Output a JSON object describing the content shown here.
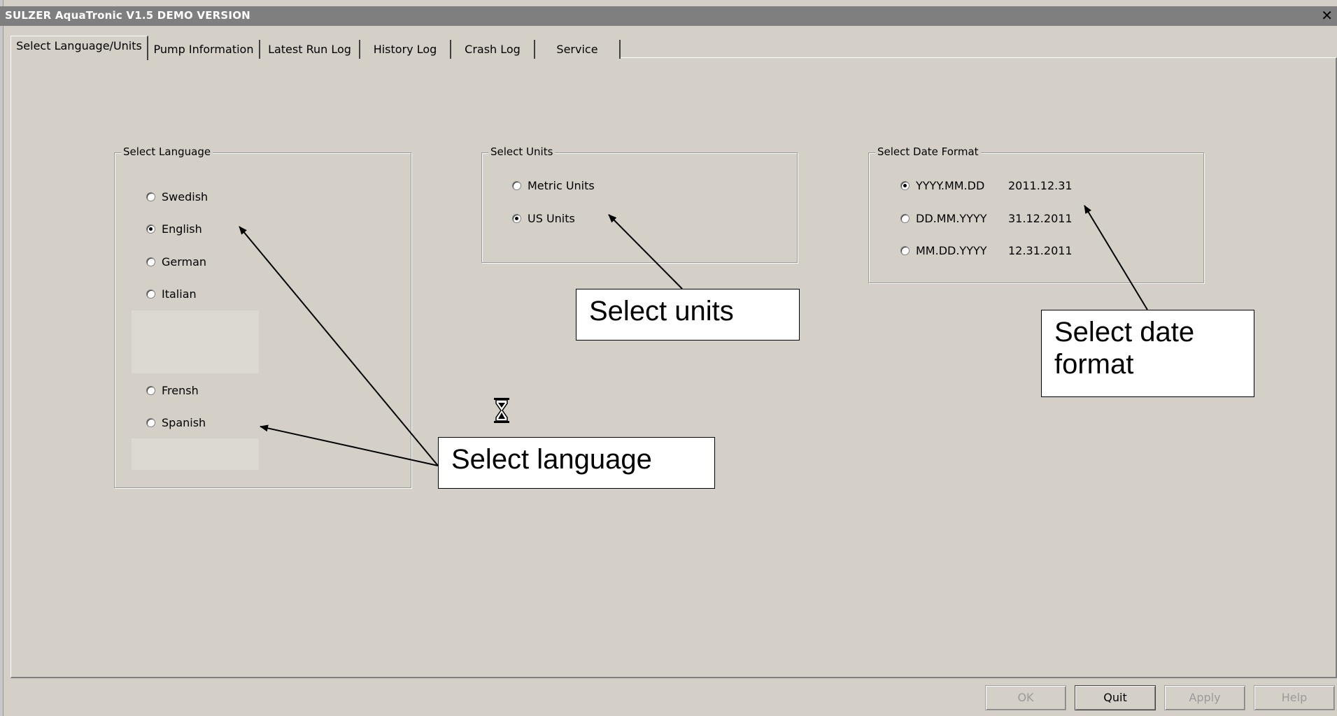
{
  "window": {
    "title": "SULZER AquaTronic V1.5 DEMO VERSION",
    "close_icon": "close-x"
  },
  "tabs": [
    {
      "label": "Select Language/Units",
      "active": true
    },
    {
      "label": "Pump Information"
    },
    {
      "label": "Latest Run Log"
    },
    {
      "label": "History Log"
    },
    {
      "label": "Crash Log"
    },
    {
      "label": "Service"
    }
  ],
  "language_group": {
    "legend": "Select Language",
    "options": [
      {
        "label": "Swedish",
        "checked": false
      },
      {
        "label": "English",
        "checked": true
      },
      {
        "label": "German",
        "checked": false
      },
      {
        "label": "Italian",
        "checked": false
      },
      {
        "label": "Frensh",
        "checked": false
      },
      {
        "label": "Spanish",
        "checked": false
      }
    ]
  },
  "units_group": {
    "legend": "Select Units",
    "options": [
      {
        "label": "Metric Units",
        "checked": false
      },
      {
        "label": "US Units",
        "checked": true
      }
    ]
  },
  "date_group": {
    "legend": "Select Date Format",
    "options": [
      {
        "label": "YYYY.MM.DD",
        "sample": "2011.12.31",
        "checked": true
      },
      {
        "label": "DD.MM.YYYY",
        "sample": "31.12.2011",
        "checked": false
      },
      {
        "label": "MM.DD.YYYY",
        "sample": "12.31.2011",
        "checked": false
      }
    ]
  },
  "callouts": {
    "units": "Select units",
    "date_format": "Select date format",
    "language": "Select language"
  },
  "buttons": {
    "ok": "OK",
    "quit": "Quit",
    "apply": "Apply",
    "help": "Help"
  },
  "icons": {
    "cursor": "hourglass-icon"
  }
}
